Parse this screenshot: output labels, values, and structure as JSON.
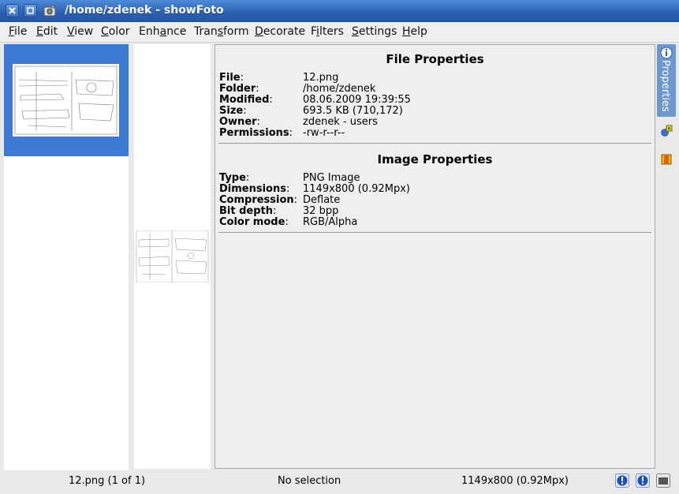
{
  "window": {
    "title": "/home/zdenek - showFoto"
  },
  "menubar": {
    "items": [
      {
        "label": "File",
        "mnemonic_index": 0
      },
      {
        "label": "Edit",
        "mnemonic_index": 0
      },
      {
        "label": "View",
        "mnemonic_index": 0
      },
      {
        "label": "Color",
        "mnemonic_index": 0
      },
      {
        "label": "Enhance",
        "mnemonic_index": 4
      },
      {
        "label": "Transform",
        "mnemonic_index": 3
      },
      {
        "label": "Decorate",
        "mnemonic_index": 0
      },
      {
        "label": "Filters",
        "mnemonic_index": 1
      },
      {
        "label": "Settings",
        "mnemonic_index": 0
      },
      {
        "label": "Help",
        "mnemonic_index": 0
      }
    ]
  },
  "file_properties": {
    "title": "File Properties",
    "rows": [
      {
        "key": "File",
        "value": "12.png"
      },
      {
        "key": "Folder",
        "value": "/home/zdenek"
      },
      {
        "key": "Modified",
        "value": "08.06.2009 19:39:55"
      },
      {
        "key": "Size",
        "value": "693.5 KB (710,172)"
      },
      {
        "key": "Owner",
        "value": "zdenek - users"
      },
      {
        "key": "Permissions",
        "value": "-rw-r--r--"
      }
    ]
  },
  "image_properties": {
    "title": "Image Properties",
    "rows": [
      {
        "key": "Type",
        "value": "PNG Image"
      },
      {
        "key": "Dimensions",
        "value": "1149x800 (0.92Mpx)"
      },
      {
        "key": "Compression",
        "value": "Deflate"
      },
      {
        "key": "Bit depth",
        "value": "32 bpp"
      },
      {
        "key": "Color mode",
        "value": "RGB/Alpha"
      }
    ]
  },
  "side_tabs": {
    "active_label": "Properties",
    "icons": [
      "image-info-icon",
      "geolocation-icon",
      "color-swatch-icon"
    ]
  },
  "statusbar": {
    "file_position": "12.png (1 of 1)",
    "selection": "No selection",
    "dimensions": "1149x800 (0.92Mpx)"
  },
  "colors": {
    "titlebar": "#2a5fb0",
    "selection": "#3d7ad6",
    "tab_active": "#6d98cf"
  }
}
